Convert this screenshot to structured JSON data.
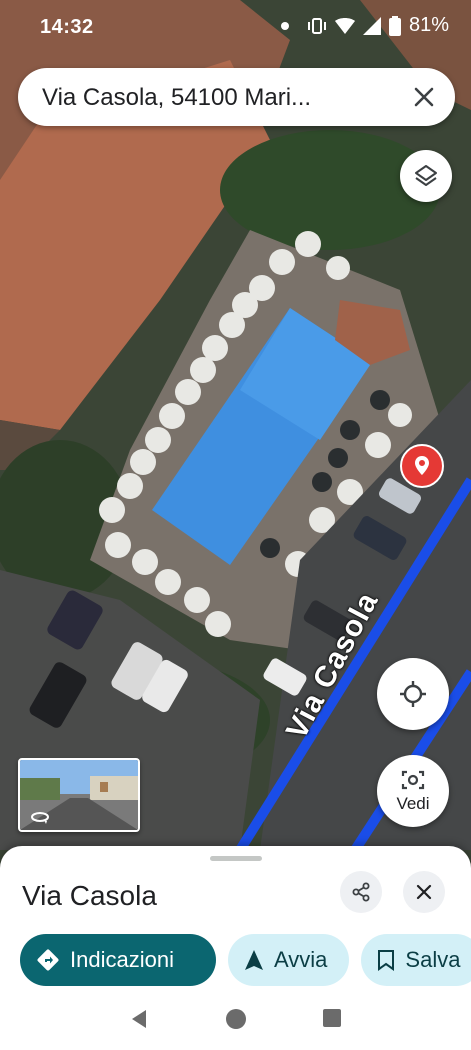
{
  "status_bar": {
    "time": "14:32",
    "battery": "81%"
  },
  "search": {
    "query": "Via Casola, 54100 Mari..."
  },
  "map": {
    "street_label": "Via Casola",
    "marker_color": "#e53935",
    "route_color": "#1a4de8"
  },
  "buttons": {
    "vedi_label": "Vedi"
  },
  "sheet": {
    "title": "Via Casola",
    "chips": [
      {
        "label": "Indicazioni",
        "icon": "directions-icon"
      },
      {
        "label": "Avvia",
        "icon": "navigation-arrow-icon"
      },
      {
        "label": "Salva",
        "icon": "bookmark-icon"
      }
    ]
  },
  "colors": {
    "primary": "#0b6670",
    "chip_soft": "#d3f0f7"
  }
}
